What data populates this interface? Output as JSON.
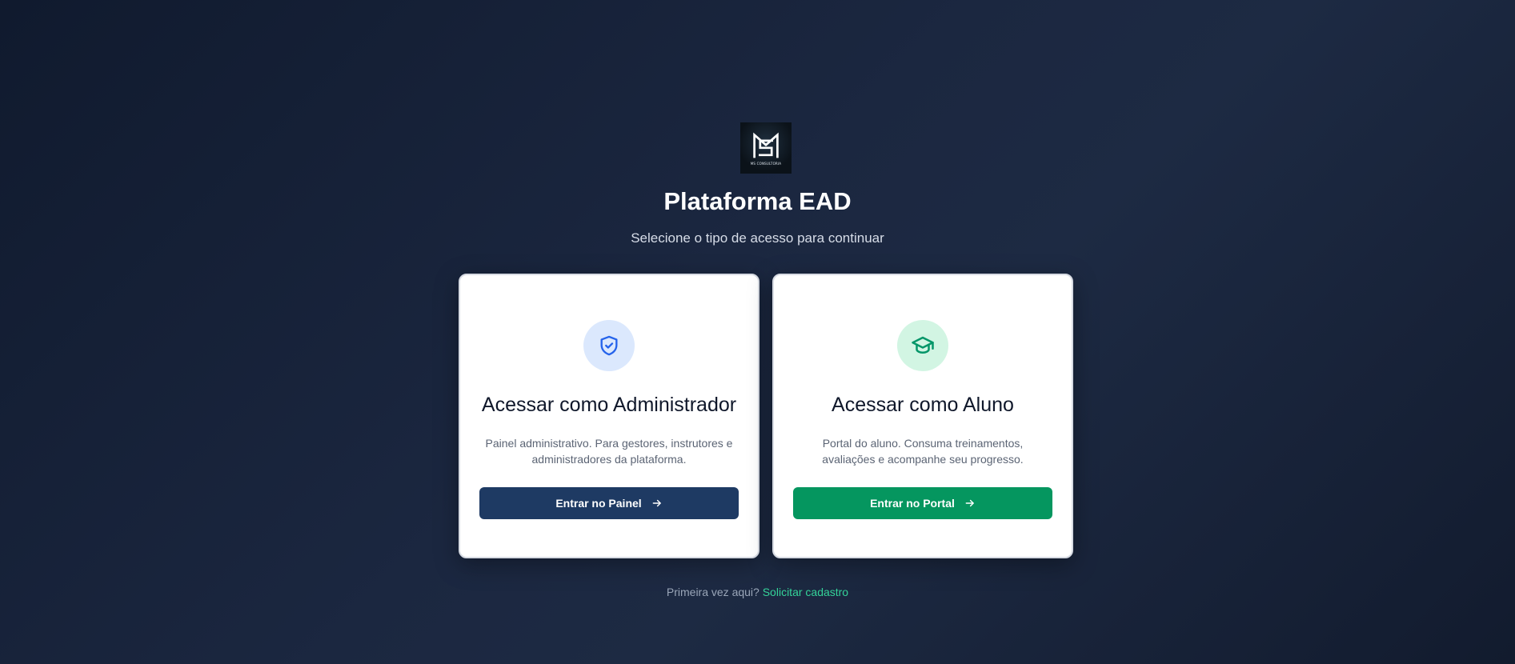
{
  "brand": {
    "logo_text": "MS CONSULTORIA",
    "title": "Plataforma EAD",
    "subtitle": "Selecione o tipo de acesso para continuar"
  },
  "cards": {
    "admin": {
      "icon": "shield-check-icon",
      "title": "Acessar como Administrador",
      "description": "Painel administrativo. Para gestores, instrutores e administradores da plataforma.",
      "button_label": "Entrar no Painel",
      "accent": "#1e3a63",
      "icon_color": "#2563eb"
    },
    "student": {
      "icon": "graduation-cap-icon",
      "title": "Acessar como Aluno",
      "description": "Portal do aluno. Consuma treinamentos, avaliações e acompanhe seu progresso.",
      "button_label": "Entrar no Portal",
      "accent": "#05965f",
      "icon_color": "#059669"
    }
  },
  "footer": {
    "prompt": "Primeira vez aqui?",
    "link_label": "Solicitar cadastro",
    "link_color": "#34d399"
  }
}
